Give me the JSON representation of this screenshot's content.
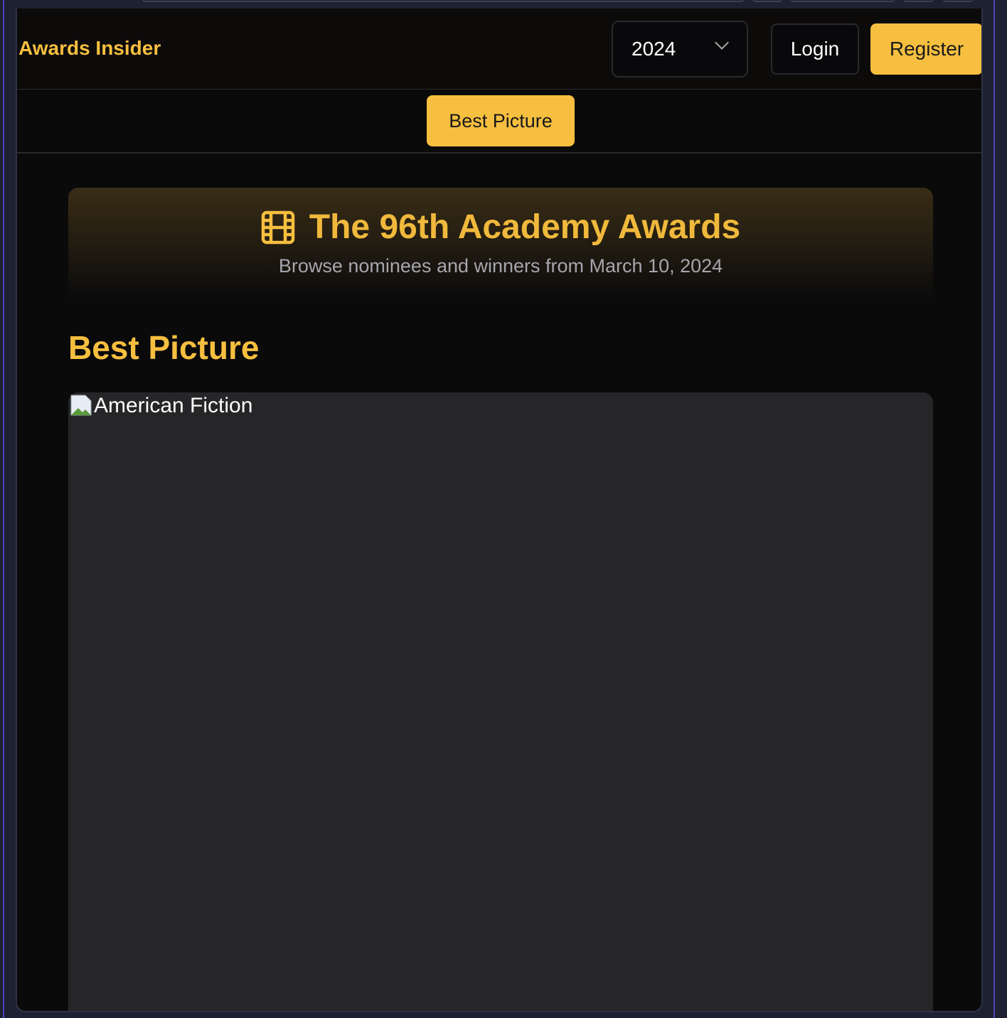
{
  "header": {
    "brand": "Awards Insider",
    "year_select": "2024",
    "login": "Login",
    "register": "Register"
  },
  "categories": [
    "Best Picture"
  ],
  "hero": {
    "icon": "film-icon",
    "title": "The 96th Academy Awards",
    "subtitle": "Browse nominees and winners from March 10, 2024"
  },
  "section": {
    "title": "Best Picture"
  },
  "nominees": [
    {
      "title": "American Fiction"
    }
  ],
  "colors": {
    "accent": "#f7bf3f",
    "background": "#0a0a0b",
    "card": "#262628"
  }
}
